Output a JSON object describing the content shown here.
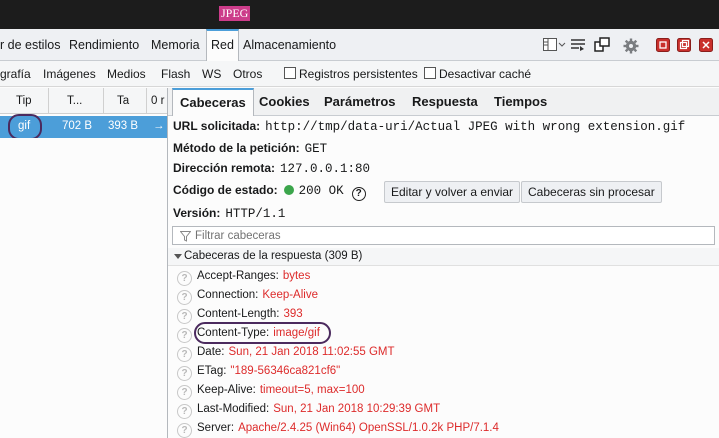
{
  "window": {
    "title": "JPEG"
  },
  "toolbar": {
    "tabs": [
      {
        "label": "r de estilos"
      },
      {
        "label": "Rendimiento"
      },
      {
        "label": "Memoria"
      },
      {
        "label": "Red"
      },
      {
        "label": "Almacenamiento"
      }
    ],
    "active_tab": "Red",
    "icons": [
      "layout-split-icon",
      "dock-icon",
      "popout-icon",
      "gear-icon",
      "close-red-icon",
      "close-red-icon",
      "close-red-icon"
    ]
  },
  "filter_bar": {
    "types": [
      "grafía",
      "Imágenes",
      "Medios",
      "Flash",
      "WS",
      "Otros"
    ],
    "checkboxes": [
      {
        "label": "Registros persistentes",
        "checked": false
      },
      {
        "label": "Desactivar caché",
        "checked": false
      }
    ]
  },
  "request_list": {
    "columns": [
      "Tip",
      "T...",
      "Ta",
      "0 r"
    ],
    "row": {
      "type": "gif",
      "transferred": "702 B",
      "size": "393 B",
      "arrow": "→"
    }
  },
  "details": {
    "tabs": [
      "Cabeceras",
      "Cookies",
      "Parámetros",
      "Respuesta",
      "Tiempos"
    ],
    "active_tab": "Cabeceras",
    "summary": {
      "url_label": "URL solicitada:",
      "url_value": "http://tmp/data-uri/Actual JPEG with wrong extension.gif",
      "method_label": "Método de la petición:",
      "method_value": "GET",
      "remote_label": "Dirección remota:",
      "remote_value": "127.0.0.1:80",
      "status_label": "Código de estado:",
      "status_value": "200 OK",
      "status_color": "#3ba54b",
      "version_label": "Versión:",
      "version_value": "HTTP/1.1"
    },
    "buttons": {
      "edit_resend": "Editar y volver a enviar",
      "raw_headers": "Cabeceras sin procesar"
    },
    "filter_placeholder": "Filtrar cabeceras",
    "response_section": "Cabeceras de la respuesta (309 B)",
    "headers": [
      {
        "name": "Accept-Ranges:",
        "value": "bytes"
      },
      {
        "name": "Connection:",
        "value": "Keep-Alive"
      },
      {
        "name": "Content-Length:",
        "value": "393"
      },
      {
        "name": "Content-Type:",
        "value": "image/gif"
      },
      {
        "name": "Date:",
        "value": "Sun, 21 Jan 2018 11:02:55 GMT"
      },
      {
        "name": "ETag:",
        "value": "\"189-56346ca821cf6\""
      },
      {
        "name": "Keep-Alive:",
        "value": "timeout=5, max=100"
      },
      {
        "name": "Last-Modified:",
        "value": "Sun, 21 Jan 2018 10:29:39 GMT"
      },
      {
        "name": "Server:",
        "value": "Apache/2.4.25 (Win64) OpenSSL/1.0.2k PHP/7.1.4"
      }
    ]
  }
}
